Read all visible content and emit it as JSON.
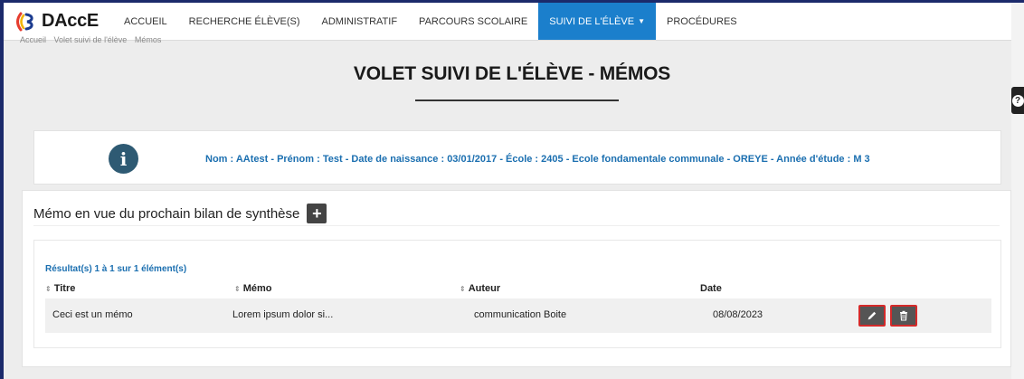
{
  "brand": {
    "name": "DAccE"
  },
  "nav": {
    "items": [
      {
        "label": "ACCUEIL",
        "active": false
      },
      {
        "label": "RECHERCHE ÉLÈVE(S)",
        "active": false
      },
      {
        "label": "ADMINISTRATIF",
        "active": false
      },
      {
        "label": "PARCOURS SCOLAIRE",
        "active": false
      },
      {
        "label": "SUIVI DE L'ÉLÈVE",
        "active": true,
        "dropdown": true
      },
      {
        "label": "PROCÉDURES",
        "active": false
      }
    ]
  },
  "breadcrumb": [
    "Accueil",
    "Volet suivi de l'élève",
    "Mémos"
  ],
  "page": {
    "title": "VOLET SUIVI DE L'ÉLÈVE - MÉMOS"
  },
  "help": {
    "label": "?"
  },
  "student": {
    "icon": "info-icon",
    "nom_label": "Nom :",
    "nom": "AAtest",
    "prenom_label": "- Prénom :",
    "prenom": "Test",
    "naissance_label": "- Date de naissance :",
    "naissance": "03/01/2017",
    "ecole_label": "- École :",
    "ecole": "2405 - Ecole fondamentale communale - OREYE",
    "annee_label": "- Année d'étude :",
    "annee": "M 3"
  },
  "memo": {
    "title": "Mémo en vue du prochain bilan de synthèse",
    "add_label": "+",
    "results_count": "Résultat(s) 1 à 1 sur 1 élément(s)",
    "columns": {
      "titre": "Titre",
      "memo": "Mémo",
      "auteur": "Auteur",
      "date": "Date"
    },
    "rows": [
      {
        "titre": "Ceci est un mémo",
        "memo": "Lorem ipsum dolor si...",
        "auteur": "communication Boite",
        "date": "08/08/2023"
      }
    ]
  },
  "colors": {
    "nav_active": "#1b7fcc",
    "link_blue": "#1b6fb0",
    "info_icon": "#2e5a73",
    "action_border": "#d42a2a",
    "frame": "#1b2a6b"
  }
}
